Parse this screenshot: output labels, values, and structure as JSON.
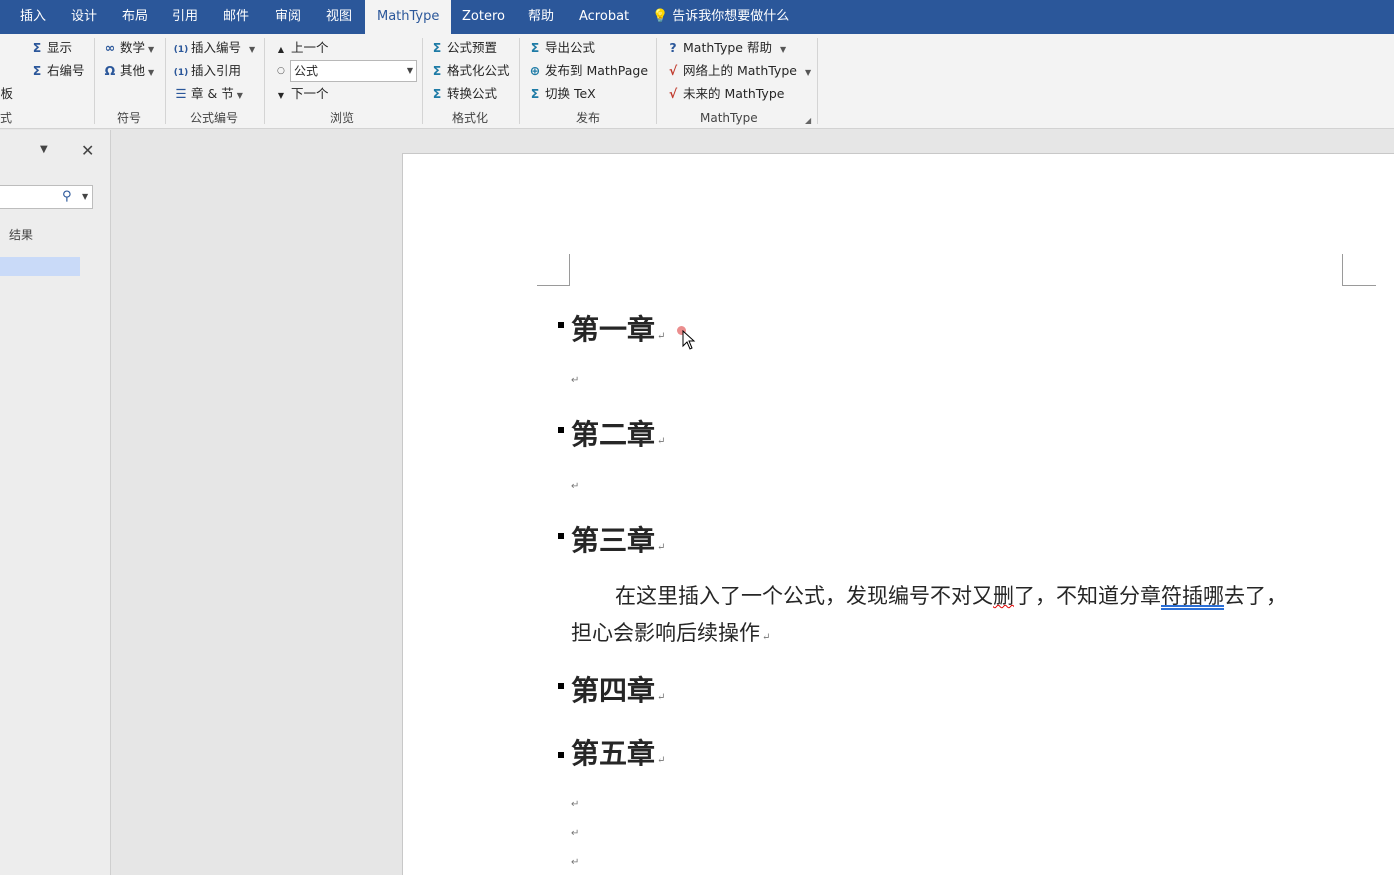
{
  "tabs": [
    {
      "label": "插入"
    },
    {
      "label": "设计"
    },
    {
      "label": "布局"
    },
    {
      "label": "引用"
    },
    {
      "label": "邮件"
    },
    {
      "label": "审阅"
    },
    {
      "label": "视图"
    },
    {
      "label": "MathType",
      "active": true
    },
    {
      "label": "Zotero"
    },
    {
      "label": "帮助"
    },
    {
      "label": "Acrobat"
    }
  ],
  "tell_me": "告诉我你想要做什么",
  "ribbon": {
    "partial_group": {
      "items": [
        "显示",
        "右编号",
        "面板"
      ],
      "label": "公式"
    },
    "symbols": {
      "items": [
        "数学",
        "其他"
      ],
      "label": "符号"
    },
    "numbering": {
      "items": [
        "插入编号",
        "插入引用",
        "章 & 节"
      ],
      "label": "公式编号"
    },
    "browse": {
      "items": [
        "上一个",
        "下一个"
      ],
      "combo_value": "公式",
      "label": "浏览"
    },
    "format": {
      "items": [
        "公式预置",
        "格式化公式",
        "转换公式"
      ],
      "label": "格式化"
    },
    "publish": {
      "items": [
        "导出公式",
        "发布到 MathPage",
        "切换 TeX"
      ],
      "label": "发布"
    },
    "mathtype": {
      "items": [
        "MathType 帮助",
        "网络上的 MathType",
        "未来的 MathType"
      ],
      "label": "MathType"
    }
  },
  "nav": {
    "results_label": "结果"
  },
  "document": {
    "headings": [
      "第一章",
      "第二章",
      "第三章",
      "第四章",
      "第五章"
    ],
    "paragraph": {
      "line1_a": "在这里插入了一个公式，发现编号不对又",
      "line1_b": "删",
      "line1_c": "了，不知道分章",
      "line1_d": "符插哪",
      "line1_e": "去了，",
      "line2": "担心会影响后续操作"
    },
    "para_mark": "↵"
  }
}
